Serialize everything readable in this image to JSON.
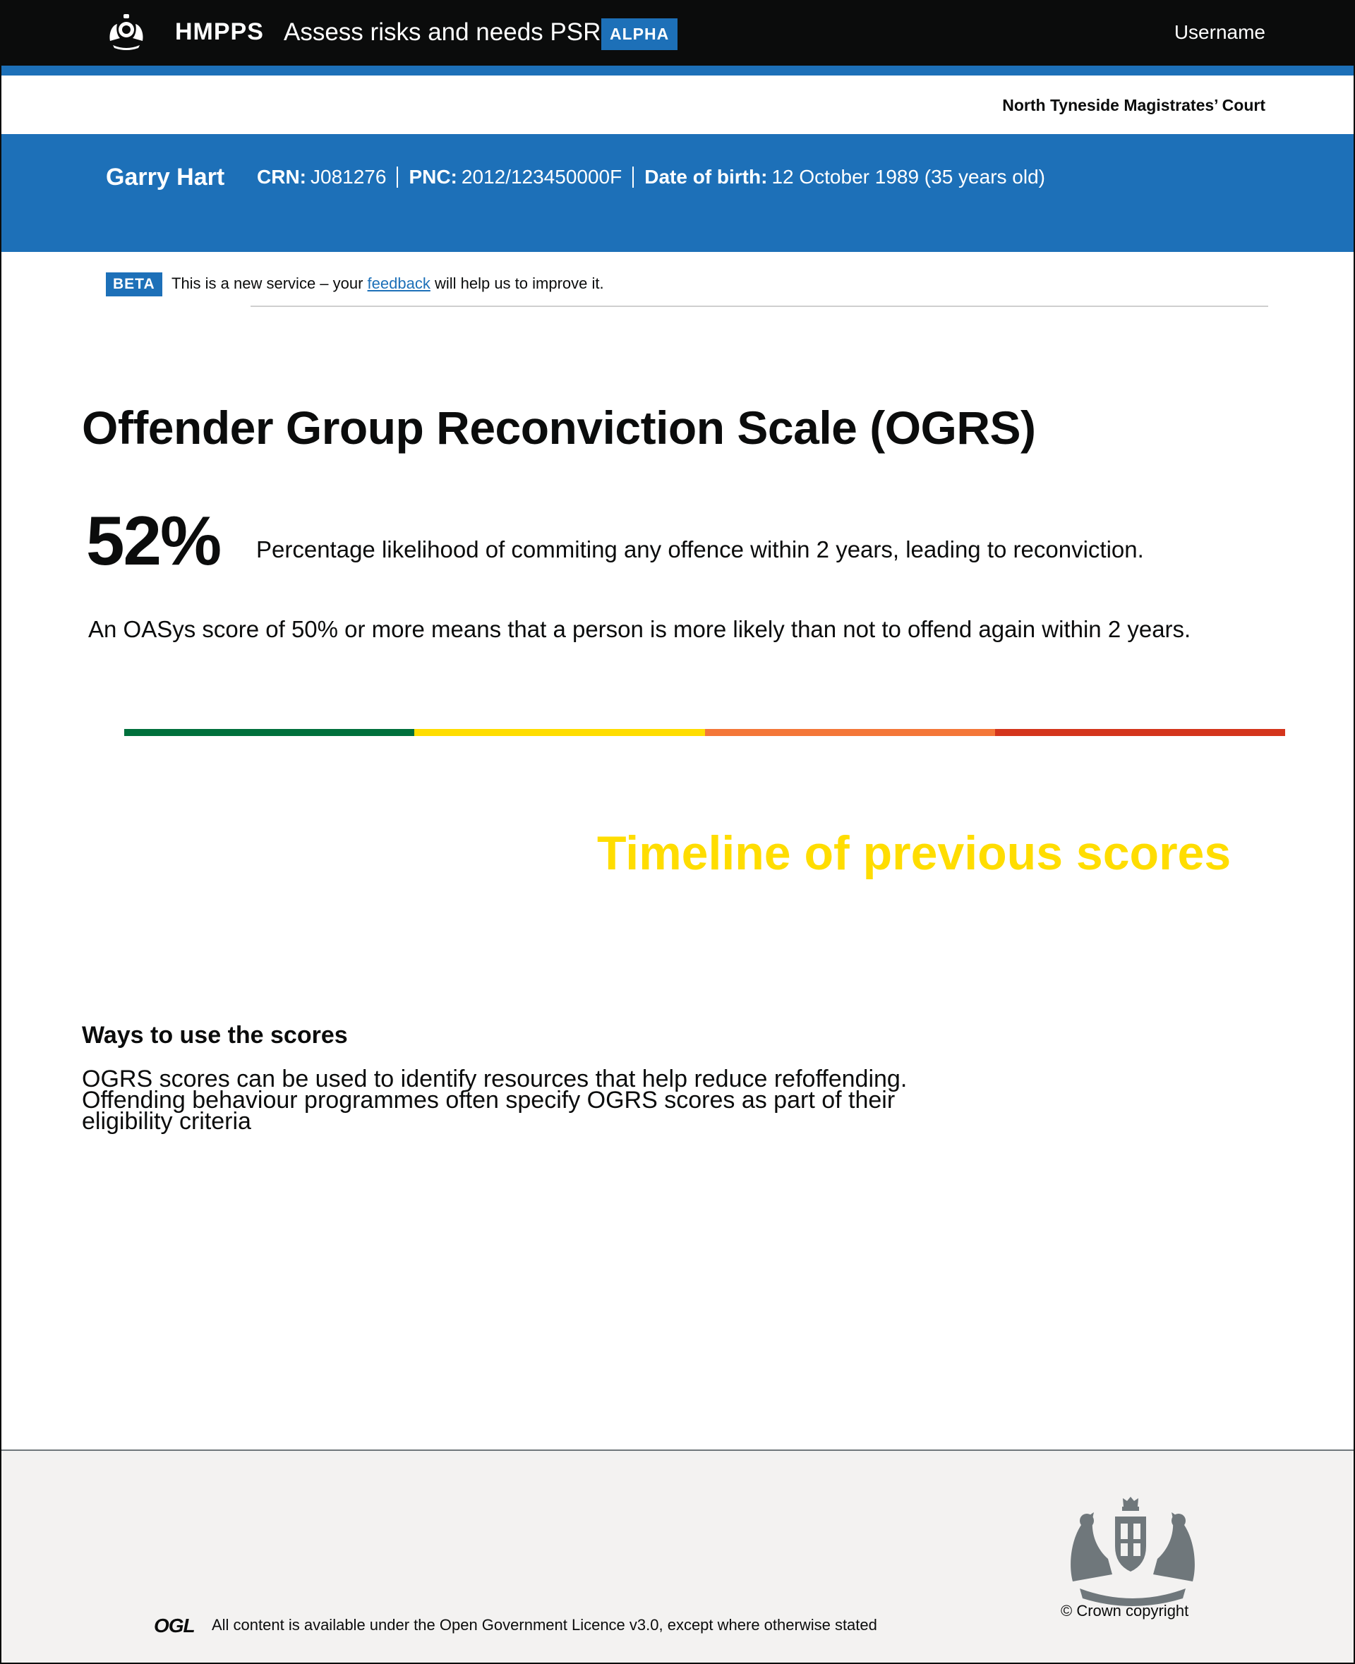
{
  "header": {
    "brand": "HMPPS",
    "service_name": "Assess risks and needs PSR",
    "phase_tag": "ALPHA",
    "username": "Username"
  },
  "court": "North Tyneside Magistrates’ Court",
  "person": {
    "name": "Garry Hart",
    "crn_label": "CRN:",
    "crn": "J081276",
    "pnc_label": "PNC:",
    "pnc": "2012/123450000F",
    "dob_label": "Date of birth:",
    "dob": "12 October 1989 (35 years old)"
  },
  "beta_banner": {
    "tag": "BETA",
    "text_before": "This is a new service – your ",
    "link": "feedback",
    "text_after": " will help us to improve it."
  },
  "main": {
    "title": "Offender Group Reconviction Scale (OGRS)",
    "score": "52%",
    "score_description": "Percentage likelihood  of commiting any offence within 2 years, leading to reconviction.",
    "explanation": "An OASys score of 50% or more means that a person is more likely than not to offend again within 2 years.",
    "risk_scale_colors": [
      "#00703c",
      "#ffdd00",
      "#f47738",
      "#d4351c"
    ],
    "timeline_heading": "Timeline of previous scores",
    "ways_heading": "Ways to use the scores",
    "ways_text": "OGRS scores can be used  to identify resources that help reduce refoffending. Offending behaviour programmes often specify OGRS scores as part of their eligibility criteria"
  },
  "footer": {
    "ogl_logo": "OGL",
    "licence": "All content is available under the Open Government Licence v3.0, except where otherwise stated",
    "copyright": "© Crown copyright"
  }
}
